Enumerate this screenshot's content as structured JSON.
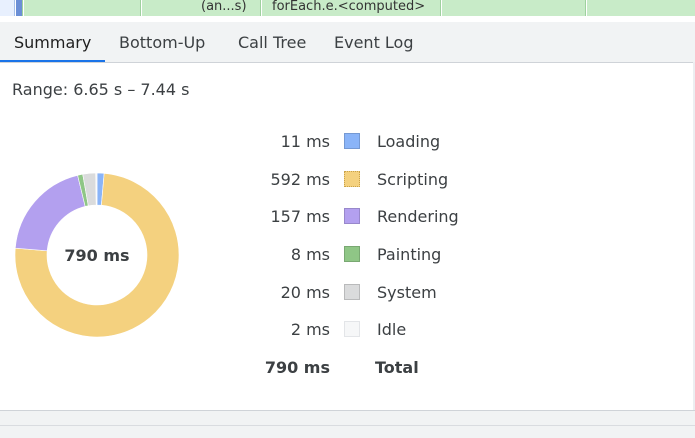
{
  "flame": {
    "left_text": "(an...s)",
    "right_text": "forEach.e.<computed>"
  },
  "tabs": [
    {
      "label": "Summary",
      "active": true
    },
    {
      "label": "Bottom-Up",
      "active": false
    },
    {
      "label": "Call Tree",
      "active": false
    },
    {
      "label": "Event Log",
      "active": false
    }
  ],
  "range": "Range: 6.65 s – 7.44 s",
  "donut": {
    "center_label": "790 ms"
  },
  "legend": [
    {
      "value": "11 ms",
      "label": "Loading",
      "ms": 11,
      "color": "#8ab4f8"
    },
    {
      "value": "592 ms",
      "label": "Scripting",
      "ms": 592,
      "color": "#f4d17f"
    },
    {
      "value": "157 ms",
      "label": "Rendering",
      "ms": 157,
      "color": "#b3a0ef"
    },
    {
      "value": "8 ms",
      "label": "Painting",
      "ms": 8,
      "color": "#8fc686"
    },
    {
      "value": "20 ms",
      "label": "System",
      "ms": 20,
      "color": "#dadbdc"
    },
    {
      "value": "2 ms",
      "label": "Idle",
      "ms": 2,
      "color": "#f6f7f8"
    }
  ],
  "total": {
    "value": "790 ms",
    "label": "Total"
  }
}
